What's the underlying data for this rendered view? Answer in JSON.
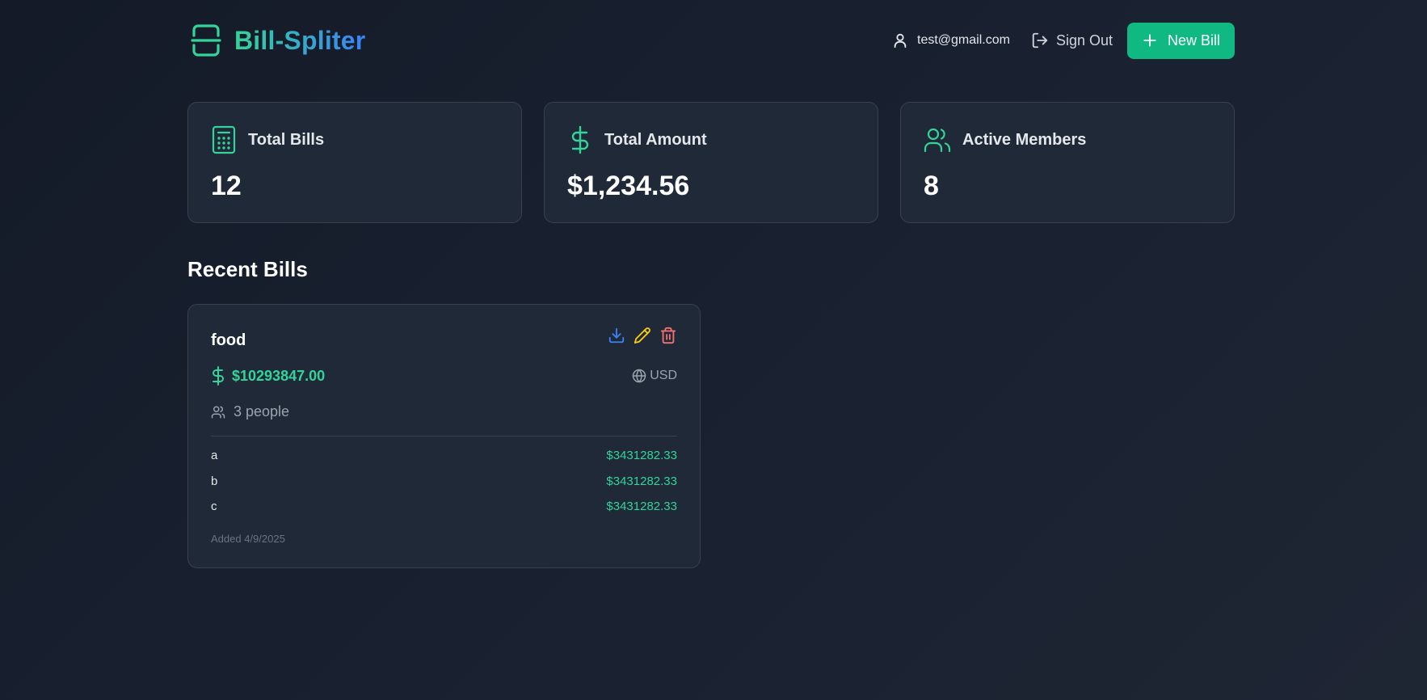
{
  "header": {
    "app_title": "Bill-Spliter",
    "user_email": "test@gmail.com",
    "signout_label": "Sign Out",
    "new_bill_label": "New Bill"
  },
  "stats": [
    {
      "label": "Total Bills",
      "value": "12",
      "icon": "calculator-icon"
    },
    {
      "label": "Total Amount",
      "value": "$1,234.56",
      "icon": "dollar-icon"
    },
    {
      "label": "Active Members",
      "value": "8",
      "icon": "users-icon"
    }
  ],
  "recent": {
    "title": "Recent Bills",
    "bills": [
      {
        "name": "food",
        "amount": "$10293847.00",
        "currency": "USD",
        "people": "3 people",
        "splits": [
          {
            "name": "a",
            "amount": "$3431282.33"
          },
          {
            "name": "b",
            "amount": "$3431282.33"
          },
          {
            "name": "c",
            "amount": "$3431282.33"
          }
        ],
        "added": "Added 4/9/2025"
      }
    ]
  },
  "colors": {
    "accent": "#10b981",
    "green_text": "#34d399",
    "blue": "#3b82f6",
    "edit": "#facc15",
    "delete": "#f87171",
    "card_bg": "#1f2937"
  }
}
